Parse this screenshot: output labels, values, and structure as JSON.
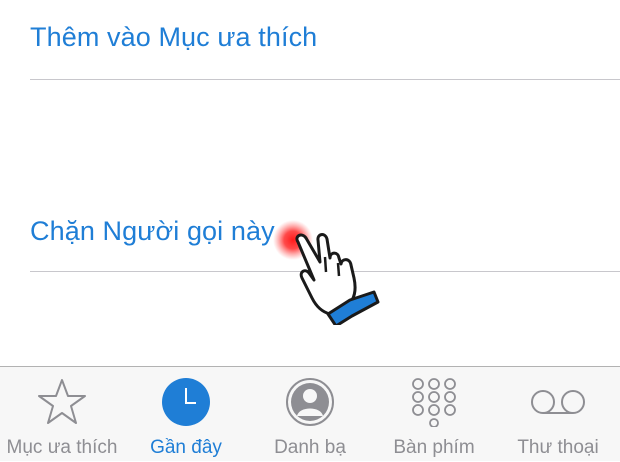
{
  "menu": {
    "add_favorite": "Thêm vào Mục ưa thích",
    "block_caller": "Chặn Người gọi này"
  },
  "tabbar": {
    "items": [
      {
        "label": "Mục ưa thích",
        "icon": "star-icon"
      },
      {
        "label": "Gần đây",
        "icon": "clock-icon",
        "active": true
      },
      {
        "label": "Danh bạ",
        "icon": "contact-icon"
      },
      {
        "label": "Bàn phím",
        "icon": "keypad-icon"
      },
      {
        "label": "Thư thoại",
        "icon": "voicemail-icon"
      }
    ]
  },
  "colors": {
    "accent": "#1f7ed6",
    "inactive": "#8e8e93",
    "tap_highlight": "#ff2b2b",
    "hand_cuff": "#1f7ed6"
  }
}
